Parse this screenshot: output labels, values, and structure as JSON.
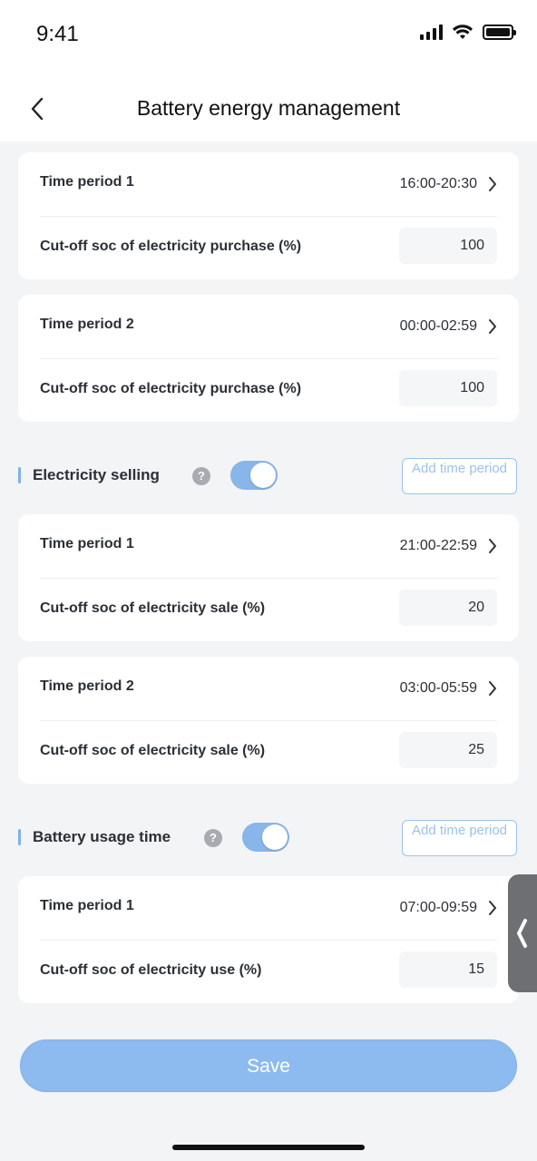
{
  "status_bar": {
    "time": "9:41"
  },
  "header": {
    "title": "Battery energy management"
  },
  "purchase_periods": [
    {
      "label": "Time period 1",
      "time": "16:00-20:30",
      "soc_label": "Cut-off soc of electricity purchase (%)",
      "soc_value": "100"
    },
    {
      "label": "Time period 2",
      "time": "00:00-02:59",
      "soc_label": "Cut-off soc of electricity purchase (%)",
      "soc_value": "100"
    }
  ],
  "selling": {
    "title": "Electricity selling",
    "help": "?",
    "enabled": true,
    "add_label": "Add time period",
    "periods": [
      {
        "label": "Time period 1",
        "time": "21:00-22:59",
        "soc_label": "Cut-off soc of electricity sale (%)",
        "soc_value": "20"
      },
      {
        "label": "Time period 2",
        "time": "03:00-05:59",
        "soc_label": "Cut-off soc of electricity sale (%)",
        "soc_value": "25"
      }
    ]
  },
  "usage": {
    "title": "Battery usage time",
    "help": "?",
    "enabled": true,
    "add_label": "Add time period",
    "periods": [
      {
        "label": "Time period 1",
        "time": "07:00-09:59",
        "soc_label": "Cut-off soc of electricity use (%)",
        "soc_value": "15"
      }
    ]
  },
  "footer": {
    "save_label": "Save"
  },
  "colors": {
    "accent": "#88b5ea",
    "background": "#f3f4f6",
    "card": "#ffffff",
    "text": "#2b2f36"
  }
}
